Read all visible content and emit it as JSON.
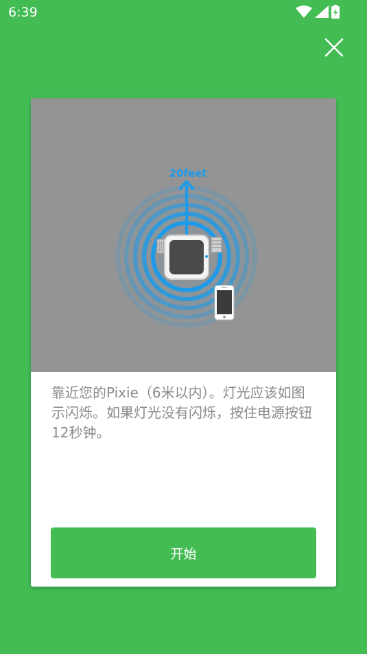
{
  "status_bar": {
    "time": "6:39",
    "icons": [
      "wifi-icon",
      "cellular-signal-icon",
      "battery-charging-icon"
    ]
  },
  "header": {
    "close_icon": "close-icon"
  },
  "card": {
    "illustration": {
      "distance_label": "20feet",
      "device_icon": "pixie-device-icon",
      "phone_icon": "smartphone-icon",
      "arrow_icon": "arrow-up-icon",
      "signal_icon": "signal-rings-icon"
    },
    "instruction": "靠近您的Pixie（6米以内）。灯光应该如图示闪烁。如果灯光没有闪烁，按住电源按钮12秒钟。",
    "start_label": "开始"
  },
  "colors": {
    "background": "#43BC54",
    "button": "#43BC54",
    "illustration_bg": "#949494",
    "signal_blue": "#1E9BE8",
    "text_gray": "#8a8a8a"
  }
}
